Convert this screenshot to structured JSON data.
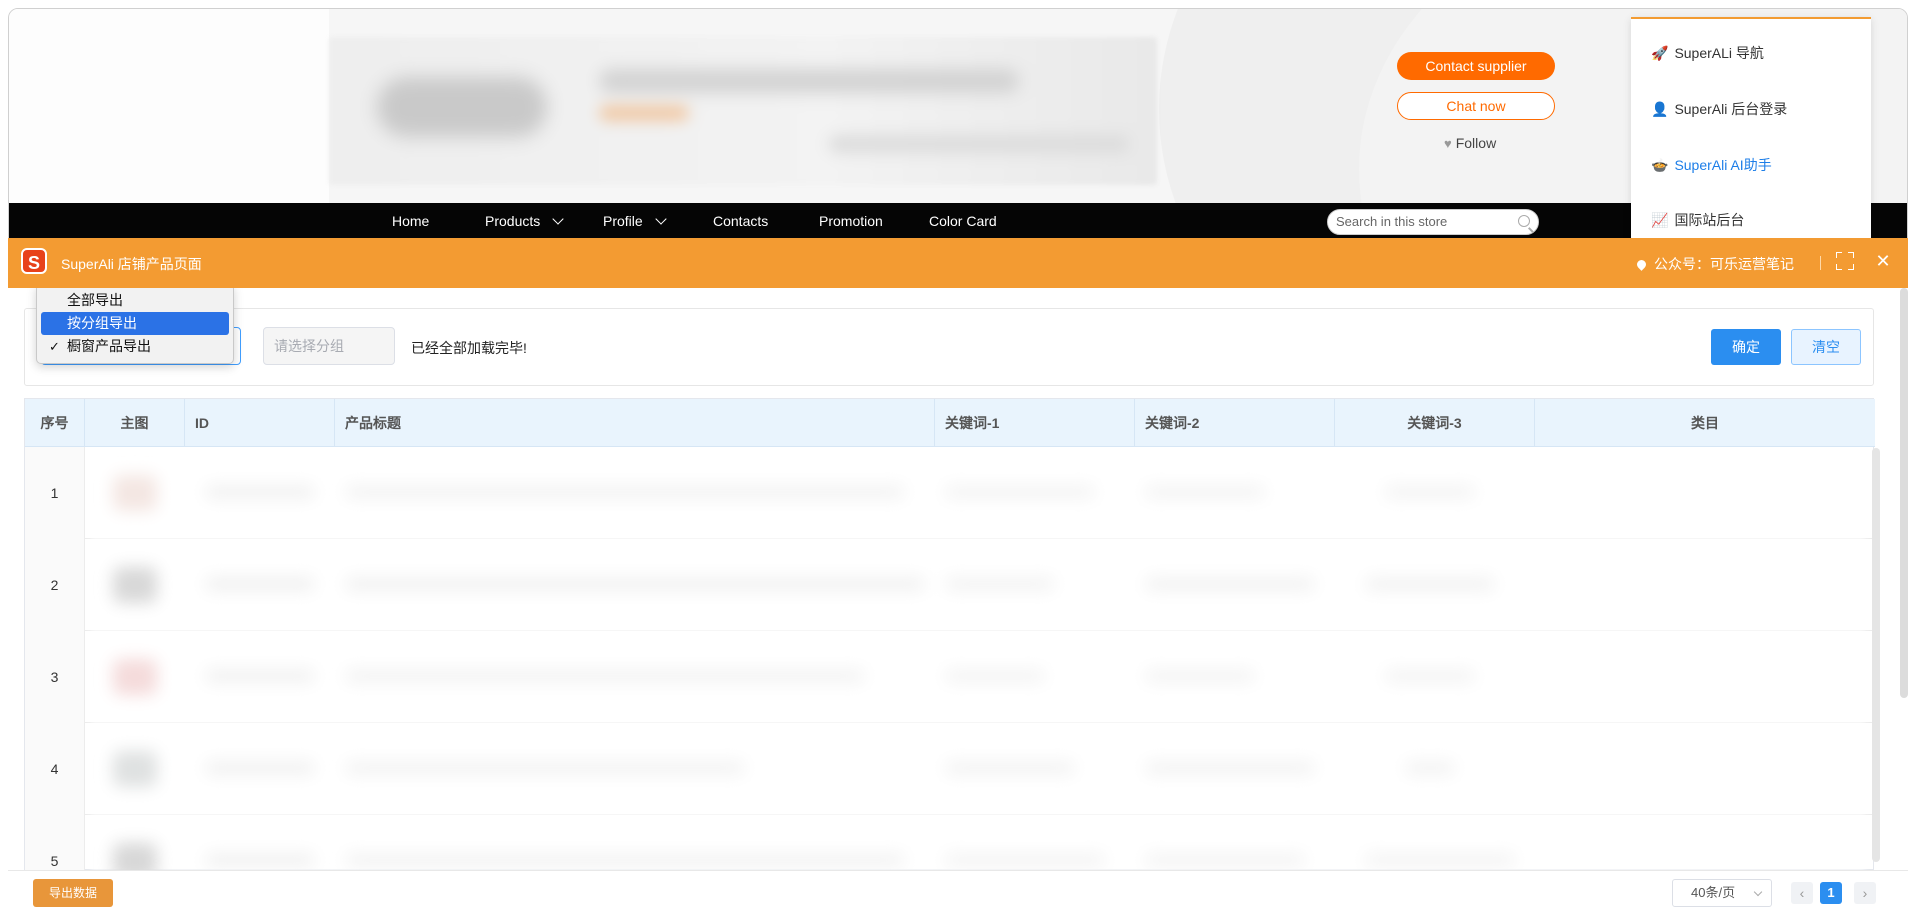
{
  "store_header": {
    "contact_label": "Contact supplier",
    "chat_label": "Chat now",
    "follow_label": "Follow"
  },
  "store_nav": {
    "items": [
      "Home",
      "Products",
      "Profile",
      "Contacts",
      "Promotion",
      "Color Card"
    ],
    "search_placeholder": "Search in this store"
  },
  "side_panel": {
    "items": [
      {
        "icon": "🚀",
        "label": "SuperALi 导航"
      },
      {
        "icon": "👤",
        "label": "SuperAli 后台登录"
      },
      {
        "icon": "🍲",
        "label": "SuperAli AI助手"
      },
      {
        "icon": "📈",
        "label": "国际站后台"
      }
    ]
  },
  "plugin": {
    "logo_letter": "S",
    "title": "SuperAli 店铺产品页面",
    "wechat_label": "公众号：可乐运营笔记",
    "mode_options": [
      "全部导出",
      "按分组导出",
      "橱窗产品导出"
    ],
    "group_placeholder": "请选择分组",
    "load_status": "已经全部加载完毕!",
    "confirm_label": "确定",
    "clear_label": "清空",
    "table": {
      "headers": [
        "序号",
        "主图",
        "ID",
        "产品标题",
        "关键词-1",
        "关键词-2",
        "关键词-3",
        "类目"
      ],
      "row_numbers": [
        "1",
        "2",
        "3",
        "4",
        "5"
      ]
    },
    "footer": {
      "export_label": "导出数据",
      "page_size": "40条/页",
      "prev": "‹",
      "current_page": "1",
      "next": "›"
    }
  }
}
